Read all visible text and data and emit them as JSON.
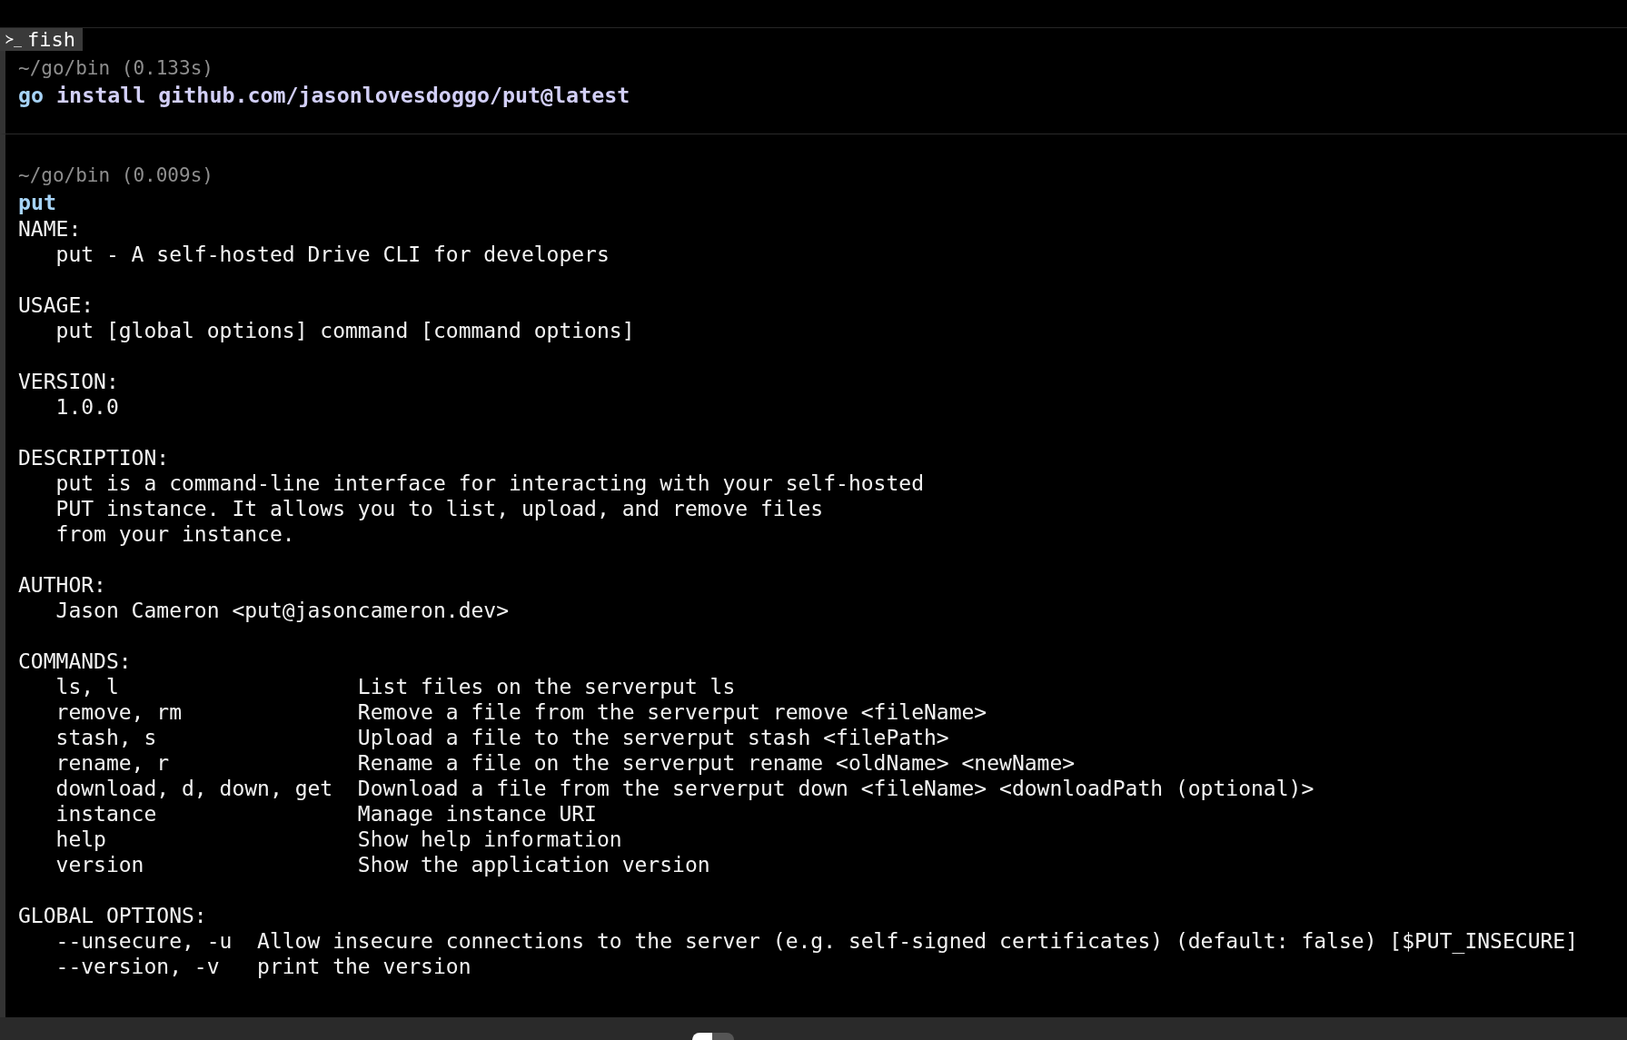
{
  "tab": {
    "icon": "≻_",
    "label": "fish"
  },
  "blocks": [
    {
      "prompt": "~/go/bin (0.133s)",
      "command": "go",
      "args": "install github.com/jasonlovesdoggo/put@latest"
    },
    {
      "prompt": "~/go/bin (0.009s)",
      "command": "put",
      "output": [
        {
          "heading": "NAME:",
          "lines": [
            "put - A self-hosted Drive CLI for developers"
          ]
        },
        {
          "heading": "USAGE:",
          "lines": [
            "put [global options] command [command options]"
          ]
        },
        {
          "heading": "VERSION:",
          "lines": [
            "1.0.0"
          ]
        },
        {
          "heading": "DESCRIPTION:",
          "lines": [
            "put is a command-line interface for interacting with your self-hosted",
            "PUT instance. It allows you to list, upload, and remove files",
            "from your instance."
          ]
        },
        {
          "heading": "AUTHOR:",
          "lines": [
            "Jason Cameron <put@jasoncameron.dev>"
          ]
        },
        {
          "heading": "COMMANDS:",
          "rows": [
            [
              "ls, l",
              "List files on the serverput ls"
            ],
            [
              "remove, rm",
              "Remove a file from the serverput remove <fileName>"
            ],
            [
              "stash, s",
              "Upload a file to the serverput stash <filePath>"
            ],
            [
              "rename, r",
              "Rename a file on the serverput rename <oldName> <newName>"
            ],
            [
              "download, d, down, get",
              "Download a file from the serverput down <fileName> <downloadPath (optional)>"
            ],
            [
              "instance",
              "Manage instance URI"
            ],
            [
              "help",
              "Show help information"
            ],
            [
              "version",
              "Show the application version"
            ]
          ]
        },
        {
          "heading": "GLOBAL OPTIONS:",
          "rows": [
            [
              "--unsecure, -u",
              "Allow insecure connections to the server (e.g. self-signed certificates) (default: false) [$PUT_INSECURE]"
            ],
            [
              "--version, -v",
              "print the version"
            ]
          ]
        }
      ]
    }
  ],
  "input_bar": {
    "toggle": {
      "on": false
    }
  }
}
